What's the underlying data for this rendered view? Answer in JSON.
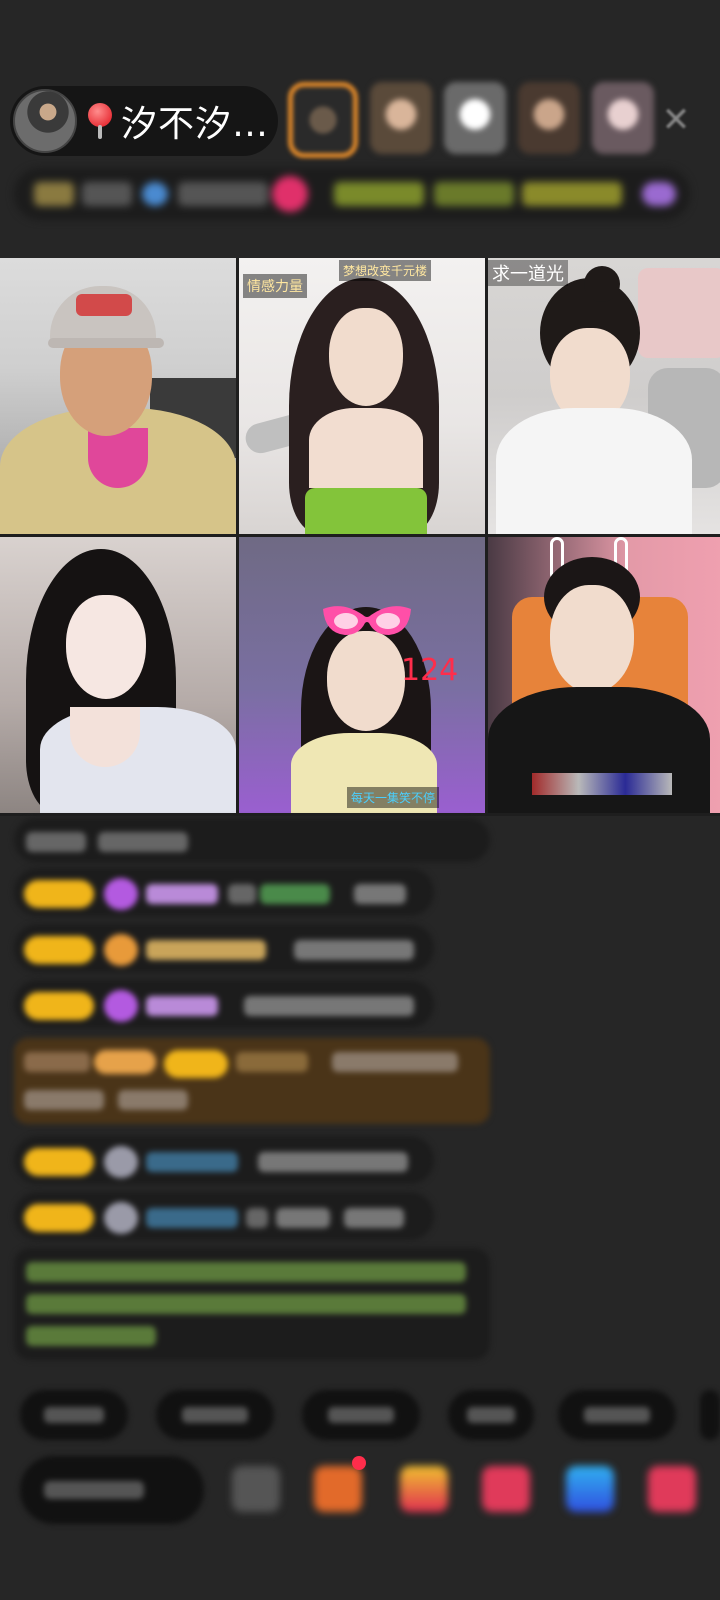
{
  "header": {
    "host_name": "汐不汐…"
  },
  "video_grid": {
    "tiles": [
      {
        "title": "",
        "tag": ""
      },
      {
        "title": "",
        "tag": "梦想改变千元楼",
        "tag2": "情感力量"
      },
      {
        "title": "求一道光",
        "tag": ""
      },
      {
        "title": "",
        "tag": ""
      },
      {
        "title": "",
        "tag": "每天一集笑不停",
        "score": "124"
      },
      {
        "title": "",
        "tag": ""
      }
    ]
  },
  "colors": {
    "background": "#262626",
    "badge": "#f0b51a",
    "accent_orange": "#e0892a",
    "score_red": "#ff2d4b"
  },
  "icons": [
    "location-pin-icon",
    "close-icon",
    "gift-icon",
    "emoji-icon"
  ]
}
